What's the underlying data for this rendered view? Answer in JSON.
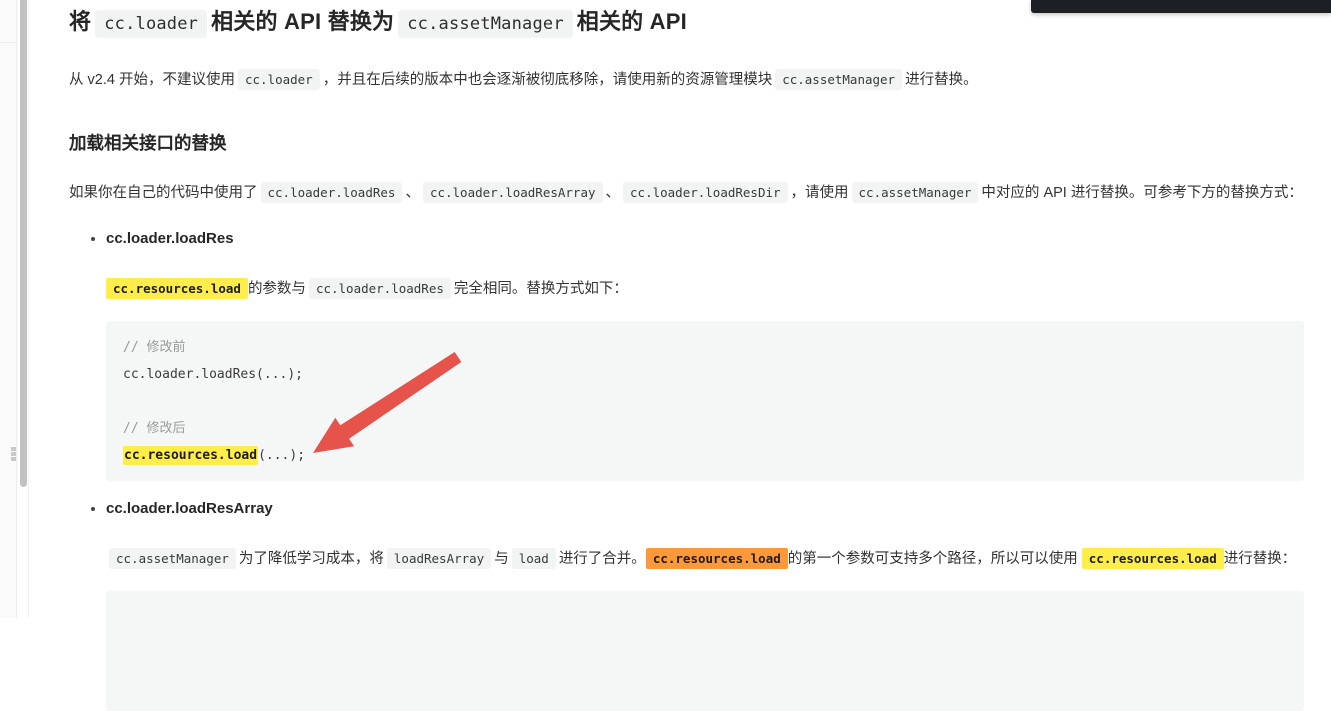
{
  "colors": {
    "highlight_yellow": "#ffee4a",
    "highlight_orange": "#ff9839",
    "arrow_red": "#e5534b",
    "overlay_dark": "#1c1f23",
    "code_bg": "#f5f6f6",
    "inline_code_bg": "#f2f3f3"
  },
  "article": {
    "title": {
      "seg0": "将",
      "code1": "cc.loader",
      "seg2": "相关的 API 替换为",
      "code3": "cc.assetManager",
      "seg4": "相关的 API"
    },
    "intro": {
      "seg0": "从 v2.4 开始，不建议使用",
      "code1": "cc.loader",
      "seg2": "，并且在后续的版本中也会逐渐被彻底移除，请使用新的资源管理模块",
      "code3": "cc.assetManager",
      "seg4": "进行替换。"
    },
    "section_heading": "加载相关接口的替换",
    "section_intro": {
      "seg0": "如果你在自己的代码中使用了",
      "code1": "cc.loader.loadRes",
      "seg2": "、",
      "code3": "cc.loader.loadResArray",
      "seg4": "、",
      "code5": "cc.loader.loadResDir",
      "seg6": "，请使用",
      "code7": "cc.assetManager",
      "seg8": "中对应的 API 进行替换。可参考下方的替换方式："
    },
    "bullet1": {
      "heading": "cc.loader.loadRes",
      "para": {
        "mark_yellow": "cc.resources.load",
        "seg1": "的参数与",
        "code2": "cc.loader.loadRes",
        "seg3": "完全相同。替换方式如下："
      },
      "code_block": {
        "comment_before": "// 修改前",
        "line_before": "cc.loader.loadRes(...);",
        "comment_after": "// 修改后",
        "line_after_mark": "cc.resources.load",
        "line_after_rest": "(...);"
      }
    },
    "bullet2": {
      "heading": "cc.loader.loadResArray",
      "para": {
        "code0": "cc.assetManager",
        "seg1": "为了降低学习成本，将",
        "code2": "loadResArray",
        "seg3": "与",
        "code4": "load",
        "seg5": "进行了合并。",
        "mark_orange": "cc.resources.load",
        "seg6": "的第一个参数可支持多个路径，所以可以使用",
        "mark_yellow": "cc.resources.load",
        "seg7": "进行替换："
      }
    }
  }
}
